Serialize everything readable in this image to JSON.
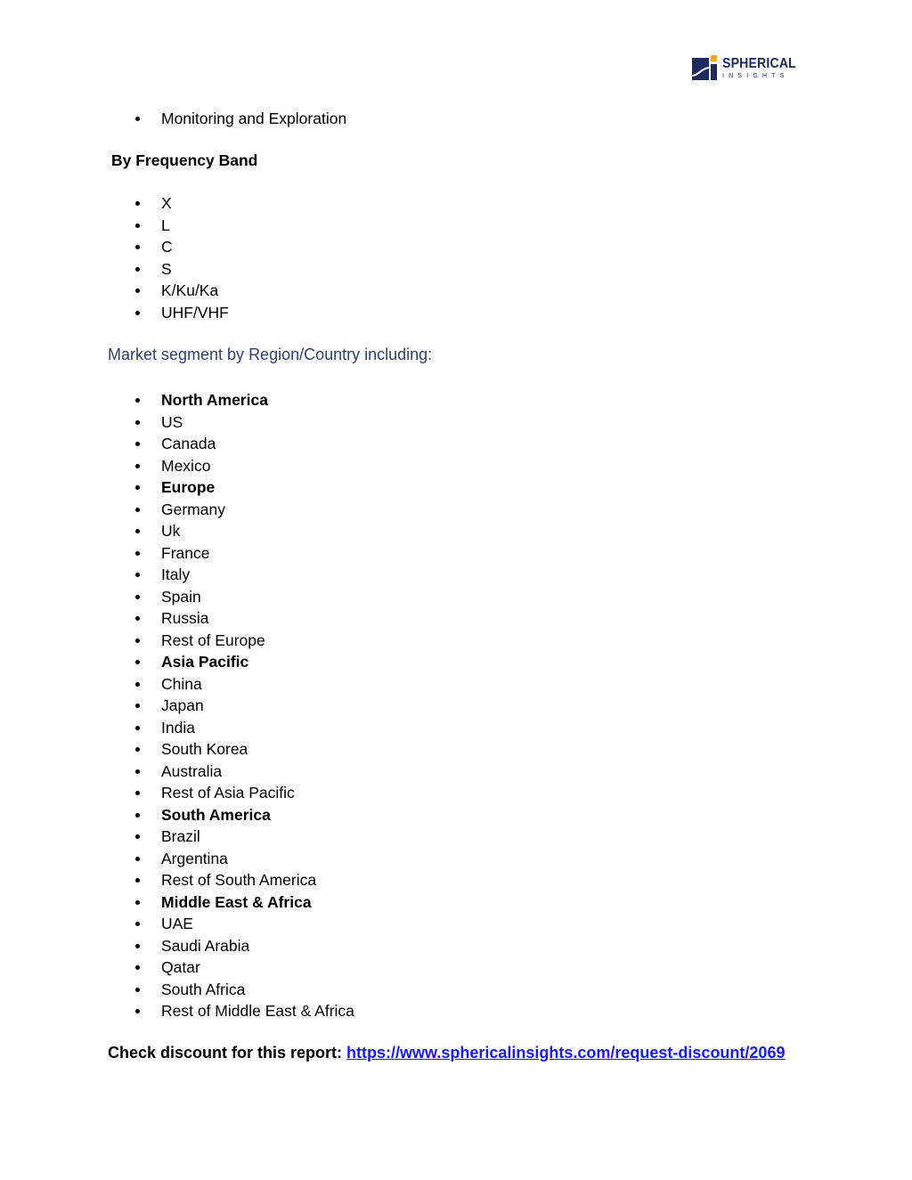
{
  "logo": {
    "title": "SPHERICAL",
    "subtitle": "INSIGHTS",
    "colors": {
      "navy": "#1d2a5c",
      "orange": "#f5a623"
    }
  },
  "application_list": {
    "items": [
      "Monitoring and Exploration"
    ]
  },
  "frequency_band": {
    "heading": "By Frequency Band",
    "items": [
      "X",
      "L",
      "C",
      "S",
      "K/Ku/Ka",
      "UHF/VHF"
    ]
  },
  "region": {
    "heading": "Market segment by Region/Country including:",
    "items": [
      {
        "label": "North America",
        "bold": true
      },
      {
        "label": "US",
        "bold": false
      },
      {
        "label": "Canada",
        "bold": false
      },
      {
        "label": "Mexico",
        "bold": false
      },
      {
        "label": "Europe",
        "bold": true
      },
      {
        "label": "Germany",
        "bold": false
      },
      {
        "label": "Uk",
        "bold": false
      },
      {
        "label": "France",
        "bold": false
      },
      {
        "label": "Italy",
        "bold": false
      },
      {
        "label": "Spain",
        "bold": false
      },
      {
        "label": "Russia",
        "bold": false
      },
      {
        "label": "Rest of Europe",
        "bold": false
      },
      {
        "label": "Asia Pacific",
        "bold": true
      },
      {
        "label": "China",
        "bold": false
      },
      {
        "label": "Japan",
        "bold": false
      },
      {
        "label": "India",
        "bold": false
      },
      {
        "label": "South Korea",
        "bold": false
      },
      {
        "label": "Australia",
        "bold": false
      },
      {
        "label": "Rest of Asia Pacific",
        "bold": false
      },
      {
        "label": "South America",
        "bold": true
      },
      {
        "label": "Brazil",
        "bold": false
      },
      {
        "label": "Argentina",
        "bold": false
      },
      {
        "label": "Rest of South America",
        "bold": false
      },
      {
        "label": "Middle East & Africa",
        "bold": true
      },
      {
        "label": "UAE",
        "bold": false
      },
      {
        "label": "Saudi Arabia",
        "bold": false
      },
      {
        "label": "Qatar",
        "bold": false
      },
      {
        "label": "South Africa",
        "bold": false
      },
      {
        "label": "Rest of Middle East & Africa",
        "bold": false
      }
    ]
  },
  "discount": {
    "label": "Check discount for this report: ",
    "link_text": "https://www.sphericalinsights.com/request-discount/2069",
    "link_color": "#1a1aee"
  }
}
